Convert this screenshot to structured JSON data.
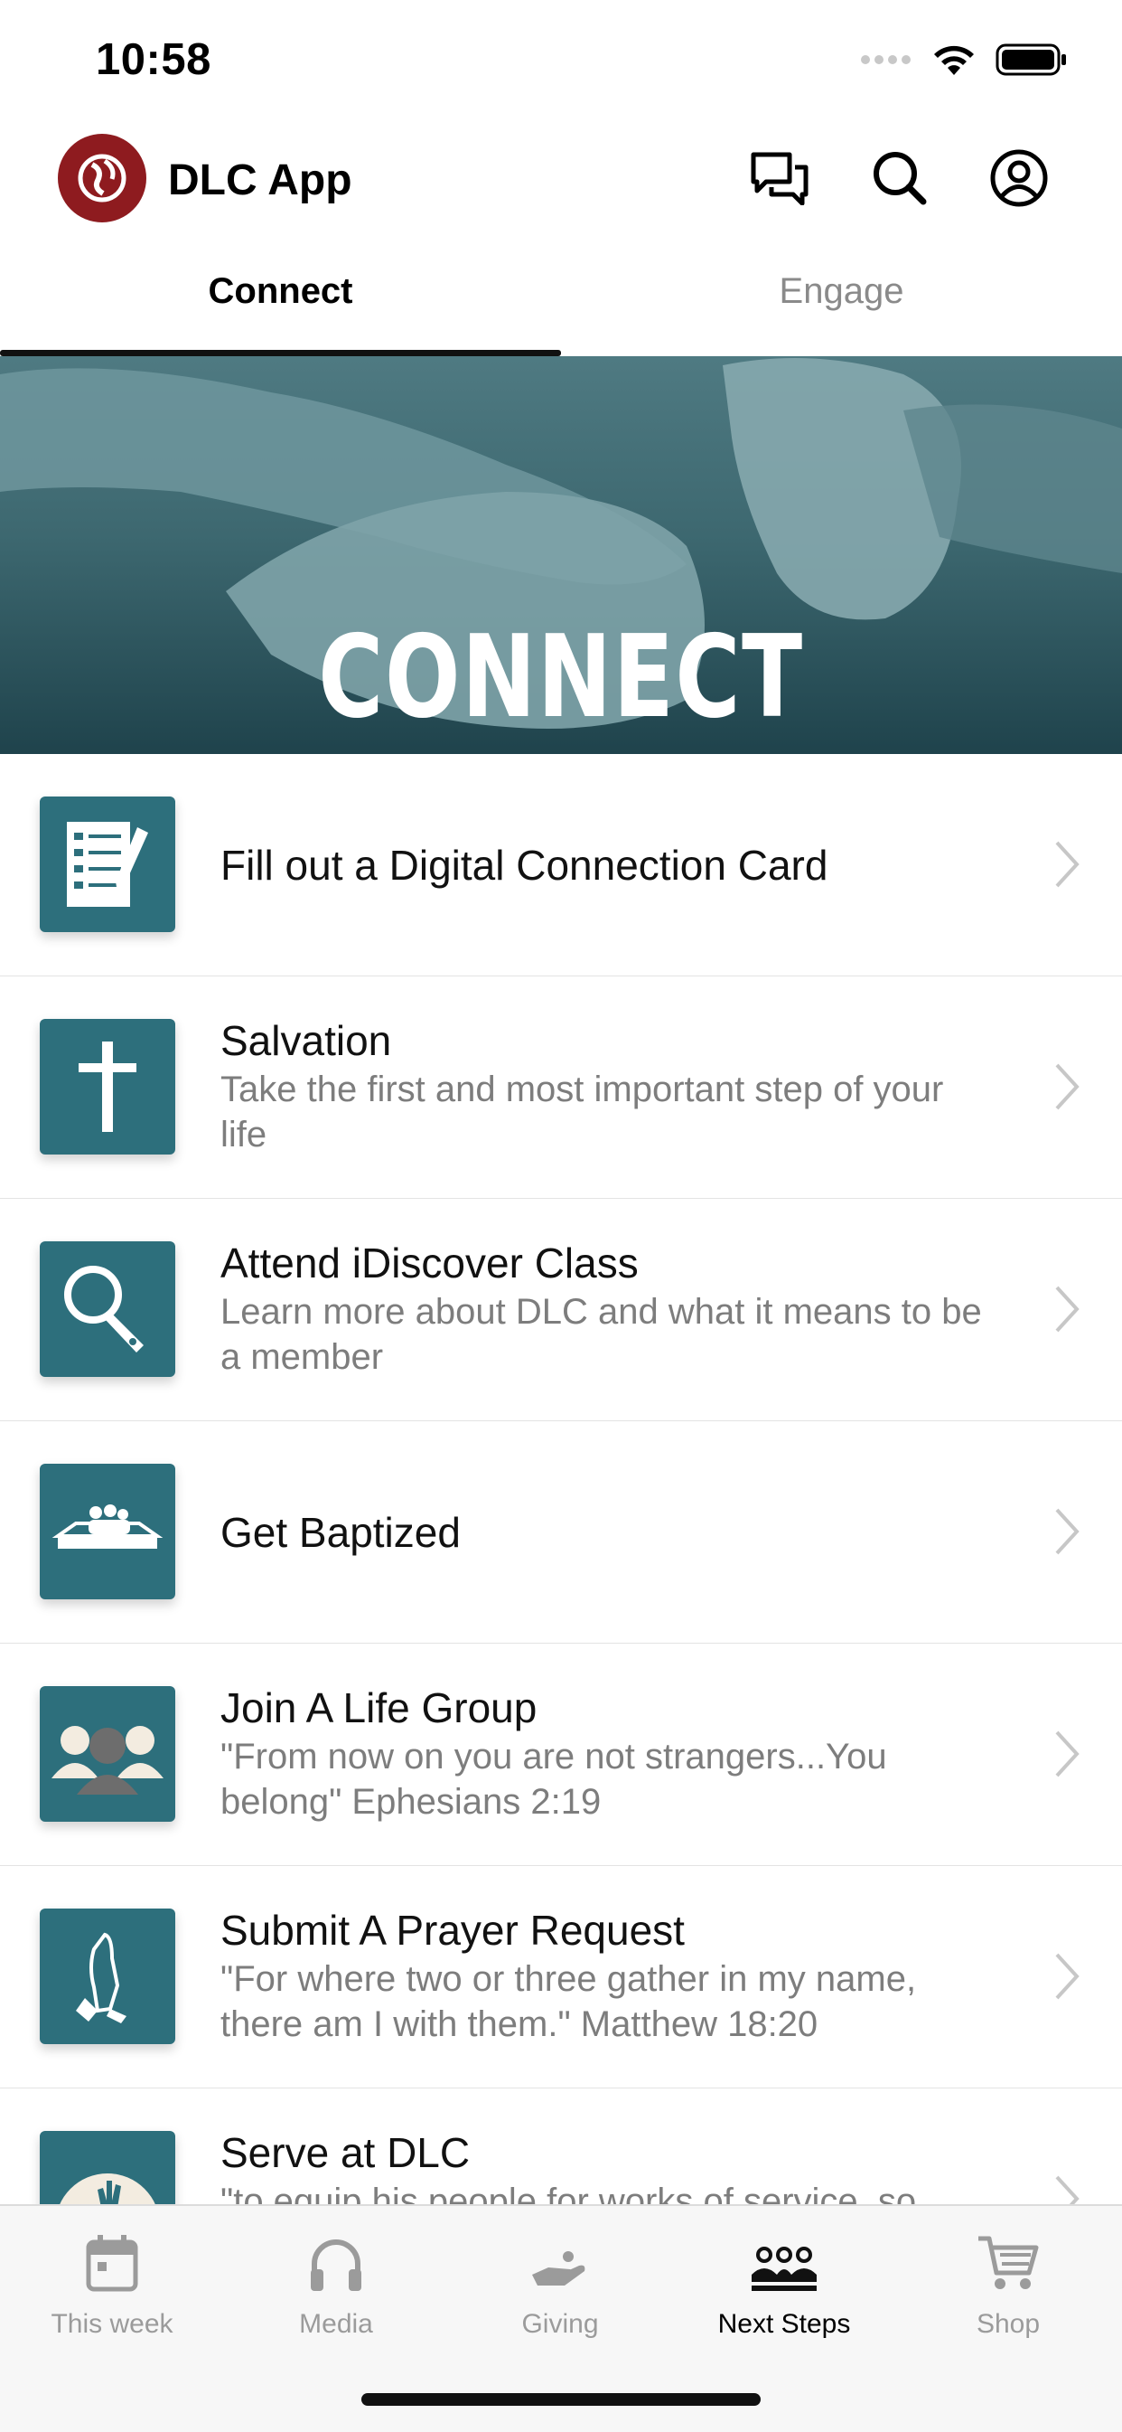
{
  "status_bar": {
    "time": "10:58"
  },
  "header": {
    "app_title": "DLC App"
  },
  "tabs": [
    {
      "label": "Connect",
      "active": true
    },
    {
      "label": "Engage",
      "active": false
    }
  ],
  "banner": {
    "title": "CONNECT"
  },
  "list_items": [
    {
      "title": "Fill out a Digital Connection Card",
      "subtitle": "",
      "icon": "connection-card-icon"
    },
    {
      "title": "Salvation",
      "subtitle": "Take the first and most important step of your life",
      "icon": "cross-icon"
    },
    {
      "title": "Attend iDiscover Class",
      "subtitle": "Learn more about DLC and what it means to be a member",
      "icon": "magnifying-glass-icon"
    },
    {
      "title": "Get Baptized",
      "subtitle": "",
      "icon": "baptism-pool-icon"
    },
    {
      "title": "Join A Life Group",
      "subtitle": "\"From now on you are not strangers...You belong\" Ephesians 2:19",
      "icon": "group-people-icon"
    },
    {
      "title": "Submit A Prayer Request",
      "subtitle": "\"For where two or three gather in my name, there am I with them.\" Matthew 18:20",
      "icon": "praying-hands-icon"
    },
    {
      "title": "Serve at DLC",
      "subtitle": "\"to equip his people for works of service, so",
      "icon": "raised-hands-icon"
    }
  ],
  "tab_bar": [
    {
      "label": "This week",
      "icon": "calendar-icon",
      "active": false
    },
    {
      "label": "Media",
      "icon": "headphones-icon",
      "active": false
    },
    {
      "label": "Giving",
      "icon": "giving-hand-icon",
      "active": false
    },
    {
      "label": "Next Steps",
      "icon": "people-group-icon",
      "active": true
    },
    {
      "label": "Shop",
      "icon": "cart-icon",
      "active": false
    }
  ],
  "colors": {
    "accent": "#2d6f7c",
    "logo": "#8e1b1f",
    "banner": "#2f5a62"
  }
}
